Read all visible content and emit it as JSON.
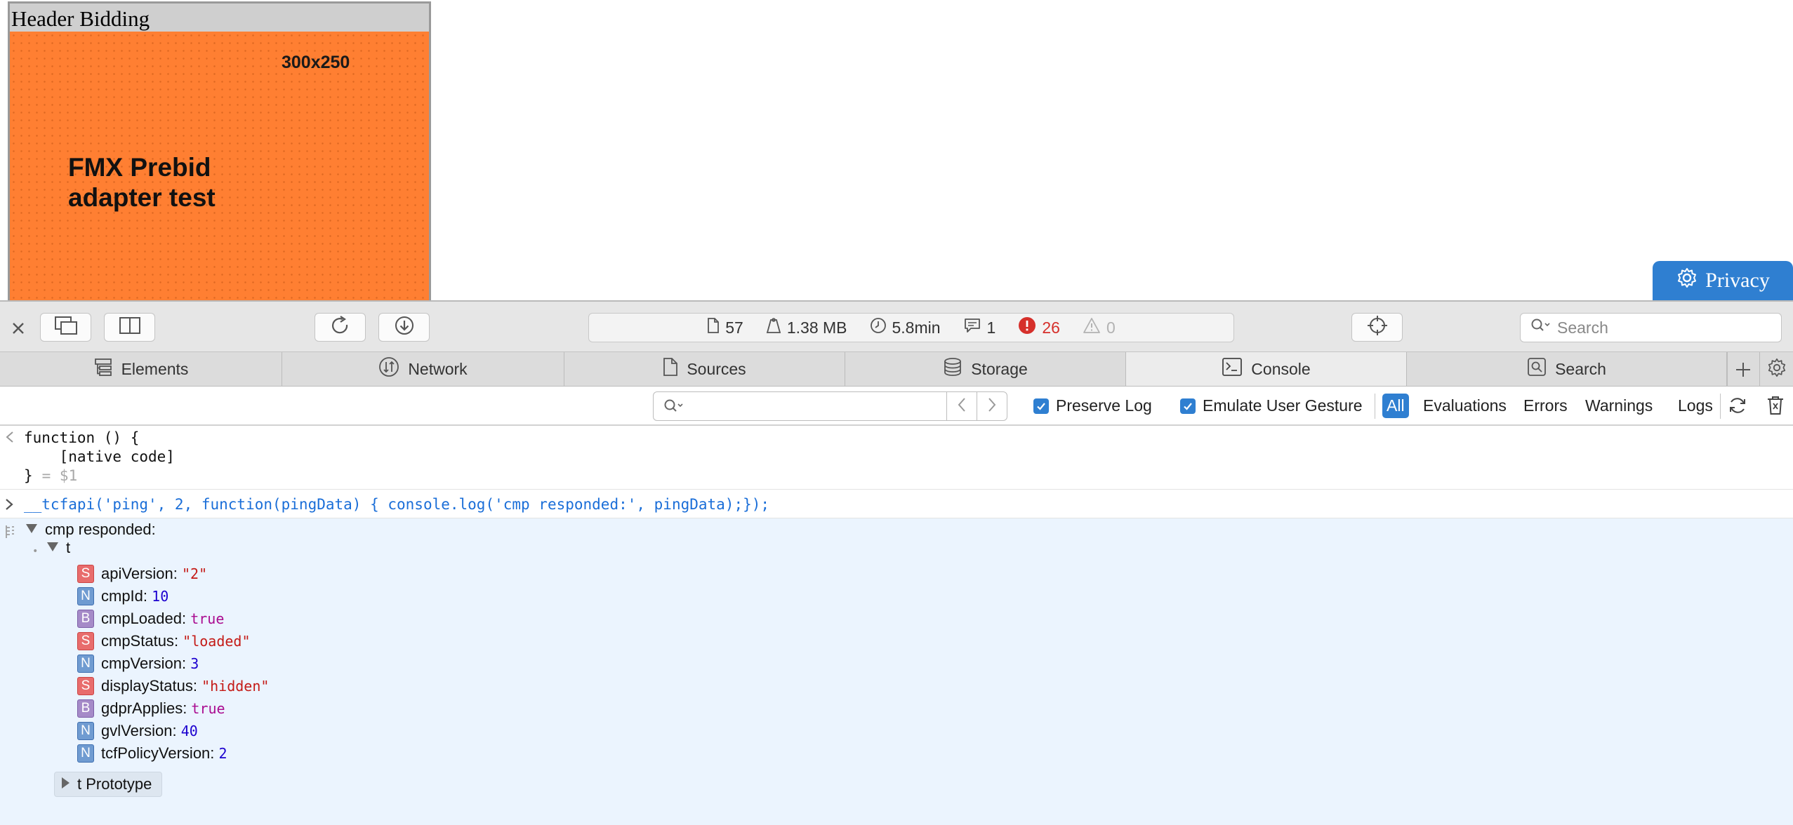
{
  "page": {
    "ad_header": "Header Bidding",
    "ad_size": "300x250",
    "ad_title": "FMX Prebid adapter test",
    "privacy_label": "Privacy"
  },
  "toolbar": {
    "search_placeholder": "Search",
    "stats": {
      "resources": "57",
      "size": "1.38 MB",
      "time": "5.8min",
      "messages": "1",
      "errors": "26",
      "warnings": "0"
    }
  },
  "tabs": [
    {
      "label": "Elements",
      "icon": "elements-icon"
    },
    {
      "label": "Network",
      "icon": "network-icon"
    },
    {
      "label": "Sources",
      "icon": "sources-icon"
    },
    {
      "label": "Storage",
      "icon": "storage-icon"
    },
    {
      "label": "Console",
      "icon": "console-icon",
      "active": true
    },
    {
      "label": "Search",
      "icon": "search-icon"
    }
  ],
  "filterbar": {
    "filter_value": "",
    "preserve_log": "Preserve Log",
    "emulate_gesture": "Emulate User Gesture",
    "filters": [
      "All",
      "Evaluations",
      "Errors",
      "Warnings",
      "Logs"
    ],
    "active_filter": "All"
  },
  "console": {
    "func_lines": [
      "function () {",
      "    [native code]",
      "}"
    ],
    "func_ref": " = $1",
    "input": "__tcfapi('ping', 2, function(pingData) { console.log('cmp responded:', pingData);});",
    "log_label": "cmp responded:",
    "object_name": "t",
    "properties": [
      {
        "type": "S",
        "key": "apiVersion",
        "value": "\"2\""
      },
      {
        "type": "N",
        "key": "cmpId",
        "value": "10"
      },
      {
        "type": "B",
        "key": "cmpLoaded",
        "value": "true"
      },
      {
        "type": "S",
        "key": "cmpStatus",
        "value": "\"loaded\""
      },
      {
        "type": "N",
        "key": "cmpVersion",
        "value": "3"
      },
      {
        "type": "S",
        "key": "displayStatus",
        "value": "\"hidden\""
      },
      {
        "type": "B",
        "key": "gdprApplies",
        "value": "true"
      },
      {
        "type": "N",
        "key": "gvlVersion",
        "value": "40"
      },
      {
        "type": "N",
        "key": "tcfPolicyVersion",
        "value": "2"
      }
    ],
    "prototype_label": "t Prototype"
  },
  "colors": {
    "accent": "#2f7fd1",
    "ad_background": "#ff7f32",
    "error": "#d6302b",
    "log_background": "#ebf4fe"
  }
}
